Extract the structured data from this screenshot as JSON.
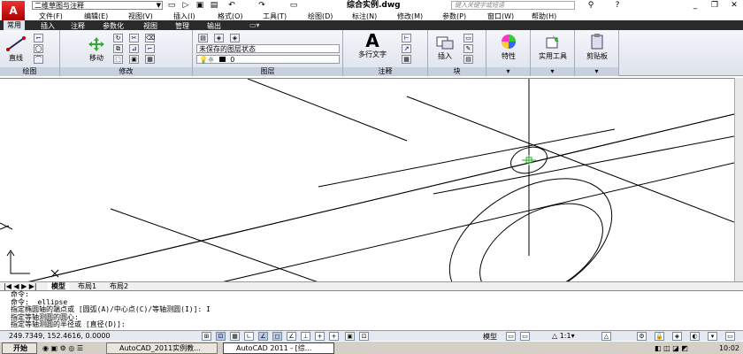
{
  "titlebar": {
    "workspace": "二维草图与注释",
    "document_title": "综合实例.dwg",
    "search_placeholder": "键入关键字或短语"
  },
  "menu": [
    "文件(F)",
    "编辑(E)",
    "视图(V)",
    "插入(I)",
    "格式(O)",
    "工具(T)",
    "绘图(D)",
    "标注(N)",
    "修改(M)",
    "参数(P)",
    "窗口(W)",
    "帮助(H)"
  ],
  "tabs": [
    "常用",
    "插入",
    "注释",
    "参数化",
    "视图",
    "管理",
    "输出"
  ],
  "ribbon": {
    "draw": {
      "line": "直线",
      "title": "绘图"
    },
    "modify": {
      "move": "移动",
      "title": "修改"
    },
    "layers": {
      "state": "未保存的图层状态",
      "current": "0",
      "title": "图层"
    },
    "annotation": {
      "mtext": "多行文字",
      "title": "注释"
    },
    "block": {
      "insert": "插入",
      "title": "块"
    },
    "properties": "特性",
    "utilities": "实用工具",
    "clipboard": "剪贴板"
  },
  "layout_tabs": [
    "模型",
    "布局1",
    "布局2"
  ],
  "command_lines": [
    "命令:",
    "命令:  ellipse",
    "指定椭圆轴的端点或 [圆弧(A)/中心点(C)/等轴测圆(I)]: I",
    "指定等轴测圆的圆心:",
    "指定等轴测圆的半径或 [直径(D)]:"
  ],
  "status": {
    "coords": "249.7349, 152.4616, 0.0000",
    "model": "模型",
    "scale": "1:1"
  },
  "taskbar": {
    "start": "开始",
    "items": [
      "AutoCAD_2011实例教...",
      "AutoCAD 2011 - [综..."
    ],
    "clock": "10:02"
  },
  "colors": {
    "tabbar_bg": "#2a2a2a",
    "ribbon_title": "#c7d0de"
  }
}
